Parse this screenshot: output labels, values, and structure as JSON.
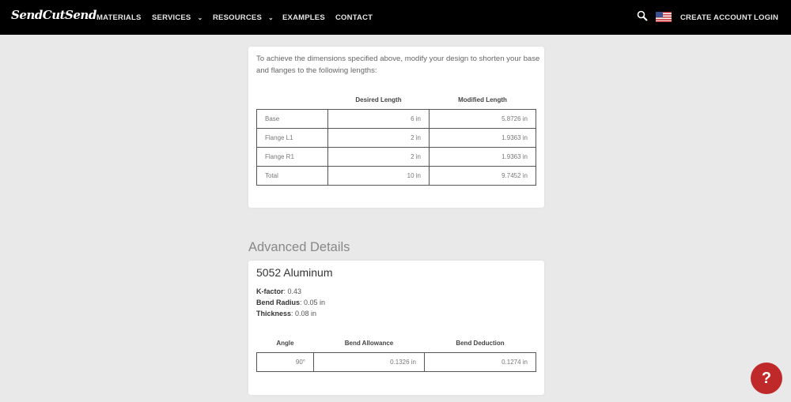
{
  "nav": {
    "logo": "SendCutSend",
    "items": [
      {
        "label": "MATERIALS",
        "dropdown": false
      },
      {
        "label": "SERVICES",
        "dropdown": true
      },
      {
        "label": "RESOURCES",
        "dropdown": true
      },
      {
        "label": "EXAMPLES",
        "dropdown": false
      },
      {
        "label": "CONTACT",
        "dropdown": false
      }
    ],
    "search_icon": "search-icon",
    "flag_icon": "us-flag-icon",
    "create_account": "CREATE ACCOUNT",
    "login": "LOGIN",
    "chevron": "⌄"
  },
  "lengths_card": {
    "intro": "To achieve the dimensions specified above, modify your design to shorten your base and flanges to the following lengths:",
    "columns": [
      "",
      "Desired Length",
      "Modified Length"
    ],
    "rows": [
      {
        "name": "Base",
        "desired": "6 in",
        "modified": "5.8726 in"
      },
      {
        "name": "Flange L1",
        "desired": "2 in",
        "modified": "1.9363 in"
      },
      {
        "name": "Flange R1",
        "desired": "2 in",
        "modified": "1.9363 in"
      },
      {
        "name": "Total",
        "desired": "10 in",
        "modified": "9.7452 in"
      }
    ]
  },
  "advanced": {
    "title": "Advanced Details",
    "material": "5052 Aluminum",
    "props": [
      {
        "label": "K-factor",
        "value": ": 0.43"
      },
      {
        "label": "Bend Radius",
        "value": ": 0.05 in"
      },
      {
        "label": "Thickness",
        "value": ": 0.08 in"
      }
    ],
    "columns": [
      "Angle",
      "Bend Allowance",
      "Bend Deduction"
    ],
    "rows": [
      {
        "angle": "90°",
        "allowance": "0.1326 in",
        "deduction": "0.1274 in"
      }
    ]
  },
  "help": {
    "label": "?",
    "icon": "help-icon",
    "color": "#c0292a"
  }
}
